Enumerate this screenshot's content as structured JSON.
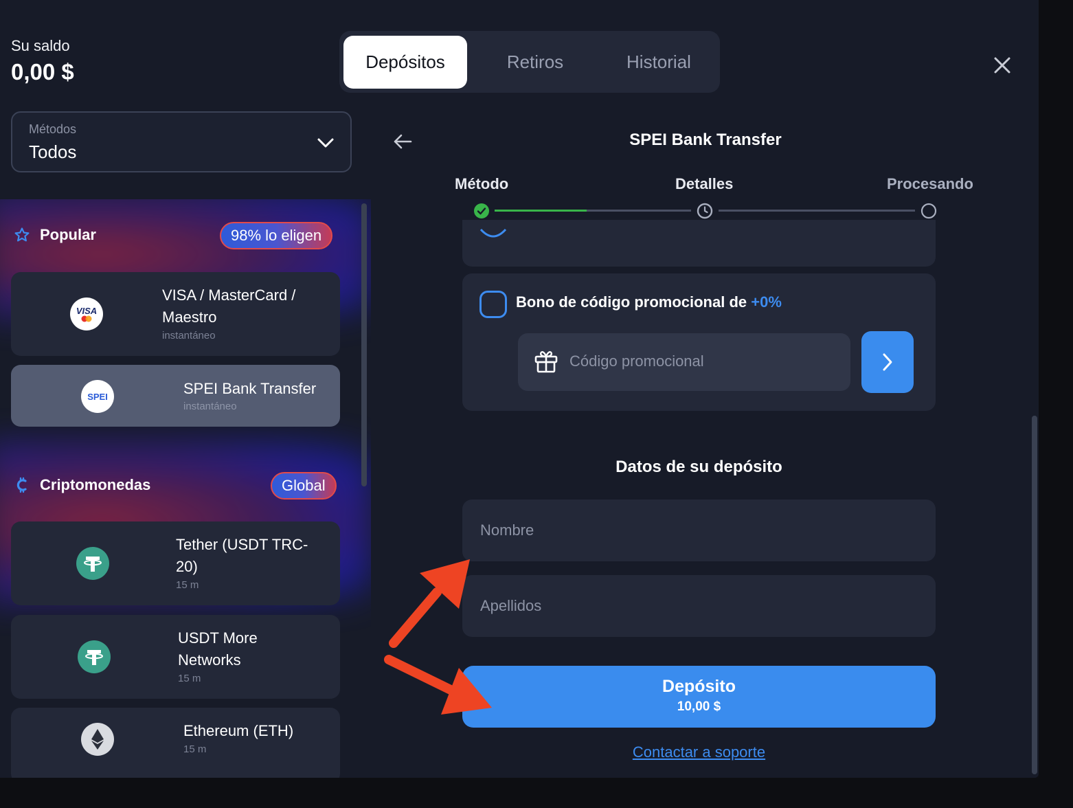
{
  "header": {
    "balance_label": "Su saldo",
    "balance_value": "0,00 $",
    "tabs": [
      {
        "label": "Depósitos",
        "active": true
      },
      {
        "label": "Retiros",
        "active": false
      },
      {
        "label": "Historial",
        "active": false
      }
    ]
  },
  "sidebar": {
    "filter": {
      "label": "Métodos",
      "value": "Todos"
    },
    "popular": {
      "title": "Popular",
      "badge": "98% lo eligen",
      "items": [
        {
          "name": "VISA / MasterCard / Maestro",
          "name_line1": "VISA / MasterCard /",
          "name_line2": "Maestro",
          "sub": "instantáneo",
          "logo_text": "VISA"
        },
        {
          "name": "SPEI Bank Transfer",
          "sub": "instantáneo",
          "logo_text": "SPEI",
          "selected": true
        }
      ]
    },
    "crypto": {
      "title": "Criptomonedas",
      "badge": "Global",
      "items": [
        {
          "name_line1": "Tether (USDT TRC-",
          "name_line2": "20)",
          "sub": "15 m"
        },
        {
          "name_line1": "USDT More",
          "name_line2": "Networks",
          "sub": "15 m"
        },
        {
          "name": "Ethereum (ETH)",
          "sub": "15 m"
        }
      ]
    }
  },
  "panel": {
    "title": "SPEI Bank Transfer",
    "steps": [
      {
        "label": "Método",
        "state": "done"
      },
      {
        "label": "Detalles",
        "state": "current"
      },
      {
        "label": "Procesando",
        "state": "pending"
      }
    ],
    "promo": {
      "label": "Bono de código promocional de",
      "percent": "+0%",
      "placeholder": "Código promocional"
    },
    "details_title": "Datos de su depósito",
    "fields": {
      "first_name_placeholder": "Nombre",
      "last_name_placeholder": "Apellidos"
    },
    "deposit_button": {
      "label": "Depósito",
      "amount": "10,00 $"
    },
    "support_link": "Contactar a soporte"
  },
  "colors": {
    "accent": "#3a8cee",
    "success": "#39b54a",
    "annotation_arrow": "#ee4423",
    "background": "#171b28",
    "card": "#232838"
  }
}
